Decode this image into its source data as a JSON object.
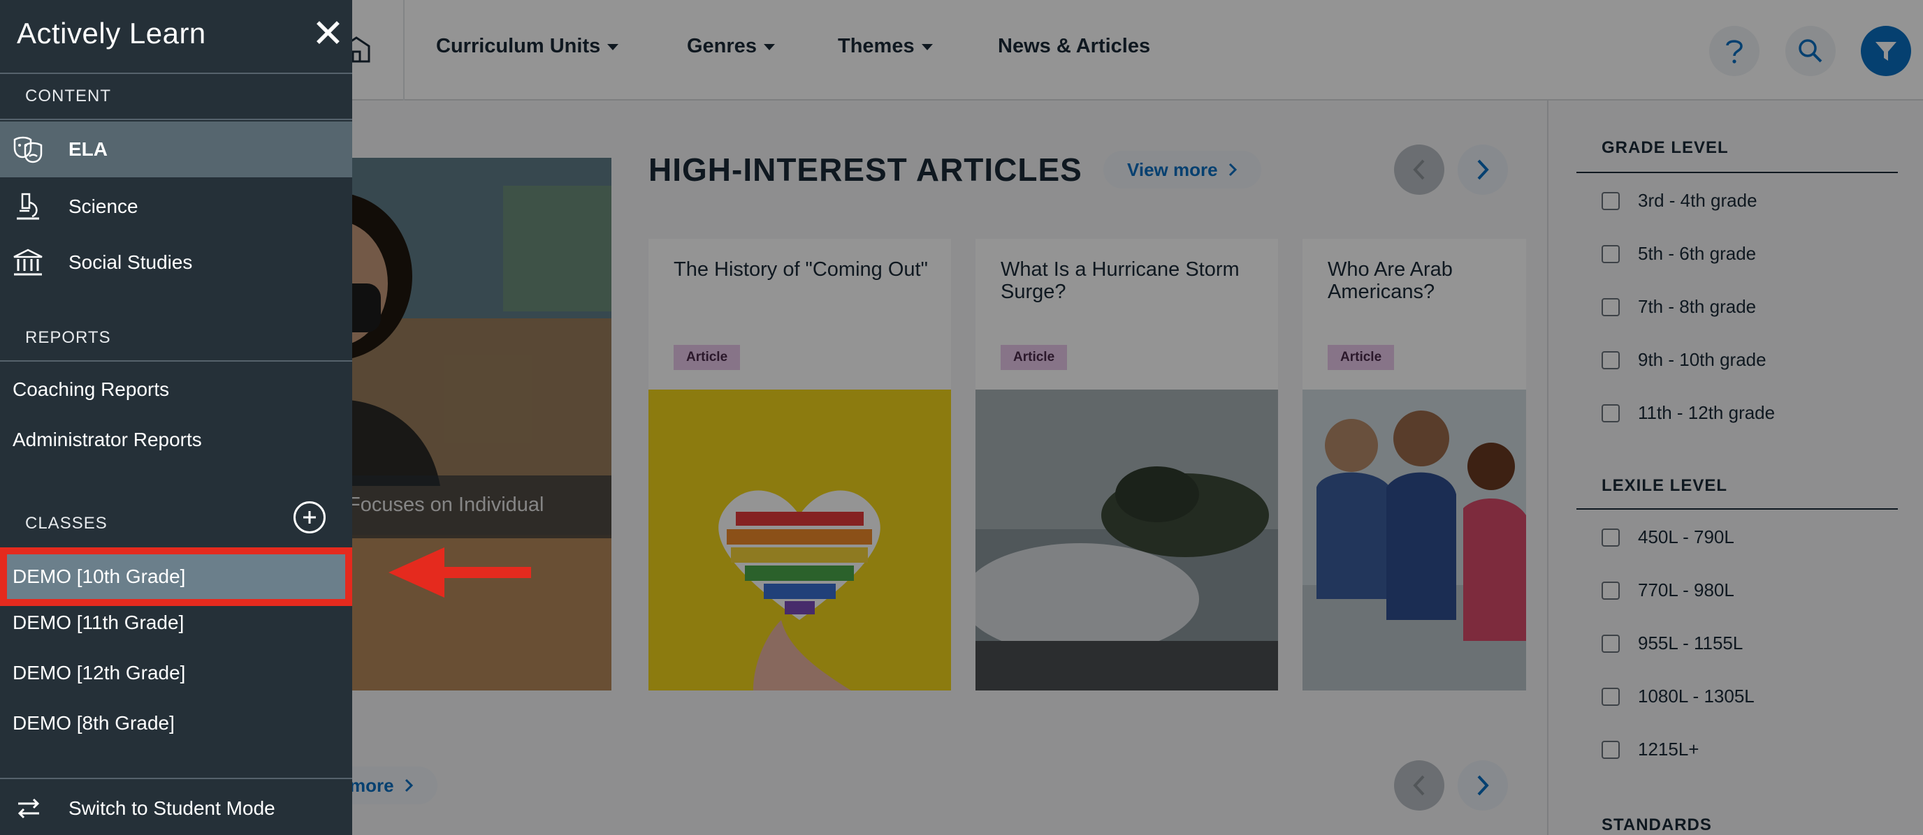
{
  "topnav": {
    "items": [
      {
        "label": "Curriculum Units",
        "dropdown": true
      },
      {
        "label": "Genres",
        "dropdown": true
      },
      {
        "label": "Themes",
        "dropdown": true
      },
      {
        "label": "News & Articles",
        "dropdown": false
      }
    ],
    "icons": [
      "home-icon",
      "help-icon",
      "search-icon",
      "filter-icon"
    ]
  },
  "main": {
    "hero": {
      "caption": "Focuses on Individual"
    },
    "section1": {
      "title": "HIGH-INTEREST ARTICLES",
      "view_more": "View more"
    },
    "section2": {
      "view_more": "more"
    },
    "articles": [
      {
        "title": "The History of \"Coming Out\"",
        "tag": "Article"
      },
      {
        "title": "What Is a Hurricane Storm Surge?",
        "tag": "Article"
      },
      {
        "title": "Who Are Arab Americans?",
        "tag": "Article"
      }
    ]
  },
  "filters": {
    "grade": {
      "heading": "GRADE LEVEL",
      "options": [
        "3rd - 4th grade",
        "5th - 6th grade",
        "7th - 8th grade",
        "9th - 10th grade",
        "11th - 12th grade"
      ]
    },
    "lexile": {
      "heading": "LEXILE LEVEL",
      "options": [
        "450L - 790L",
        "770L - 980L",
        "955L - 1155L",
        "1080L - 1305L",
        "1215L+"
      ]
    },
    "standards": {
      "heading": "STANDARDS"
    }
  },
  "drawer": {
    "logo": "Actively Learn",
    "close": "✕",
    "content_heading": "CONTENT",
    "content_items": [
      {
        "label": "ELA",
        "icon": "theater-masks-icon",
        "active": true
      },
      {
        "label": "Science",
        "icon": "microscope-icon",
        "active": false
      },
      {
        "label": "Social Studies",
        "icon": "institution-icon",
        "active": false
      }
    ],
    "reports_heading": "REPORTS",
    "reports": [
      "Coaching Reports",
      "Administrator Reports"
    ],
    "classes_heading": "CLASSES",
    "classes": [
      "DEMO [10th Grade]",
      "DEMO [11th Grade]",
      "DEMO [12th Grade]",
      "DEMO [8th Grade]"
    ],
    "switch_mode": "Switch to Student Mode"
  },
  "colors": {
    "accent": "#0a6fc2",
    "drawer_bg": "#253038",
    "highlight_border": "#e52a1e",
    "tag_bg": "#e9c8ea"
  }
}
